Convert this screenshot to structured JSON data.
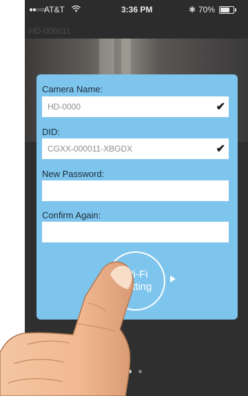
{
  "status_bar": {
    "signal": "●●○○○",
    "carrier": "AT&T",
    "wifi_icon": "wifi-icon",
    "time": "3:36 PM",
    "bluetooth": "✱",
    "battery": "70%"
  },
  "nav": {
    "title": "HD-000011"
  },
  "form": {
    "camera_name_label": "Camera Name:",
    "camera_name_value": "HD-0000",
    "did_label": "DID:",
    "did_value": "CGXX-000011-XBGDX",
    "new_password_label": "New Password:",
    "new_password_value": "",
    "confirm_label": "Confirm Again:",
    "confirm_value": "",
    "checkmark": "✔"
  },
  "wifi_button": {
    "line1": "Wi-Fi",
    "line2": "Setting"
  },
  "pager": {
    "count": 2,
    "active": 0
  },
  "colors": {
    "dialog": "#7ec5ee",
    "screen": "#2c2c2c"
  }
}
